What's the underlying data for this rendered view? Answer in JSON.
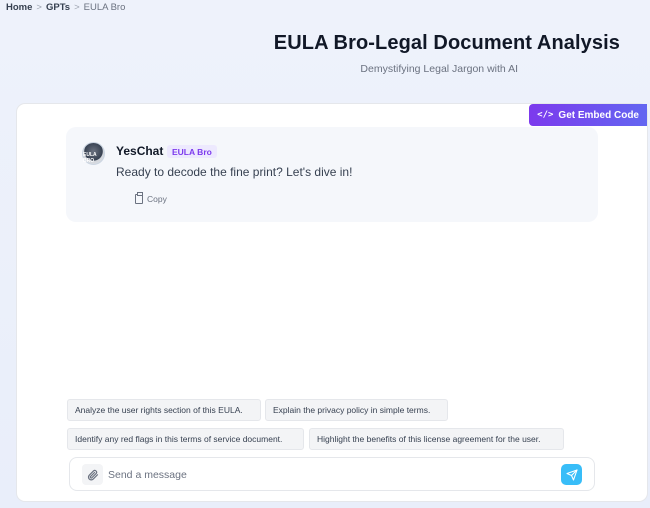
{
  "breadcrumb": {
    "home": "Home",
    "gpts": "GPTs",
    "current": "EULA Bro",
    "separator": ">"
  },
  "header": {
    "title": "EULA Bro-Legal Document Analysis",
    "subtitle": "Demystifying Legal Jargon with AI"
  },
  "embed": {
    "label": "Get Embed Code",
    "icon": "code-icon"
  },
  "message": {
    "sender": "YesChat",
    "badge": "EULA Bro",
    "text": "Ready to decode the fine print? Let's dive in!",
    "copy_label": "Copy",
    "avatar_text": "EULA BRO"
  },
  "suggestions": [
    "Analyze the user rights section of this EULA.",
    "Explain the privacy policy in simple terms.",
    "Identify any red flags in this terms of service document.",
    "Highlight the benefits of this license agreement for the user."
  ],
  "composer": {
    "placeholder": "Send a message",
    "attach_icon": "paperclip-icon",
    "send_icon": "send-icon"
  },
  "colors": {
    "accent_start": "#7c3aed",
    "accent_end": "#6366f1",
    "send": "#38bdf8",
    "badge_bg": "#ede9fe",
    "badge_text": "#7c3aed"
  }
}
